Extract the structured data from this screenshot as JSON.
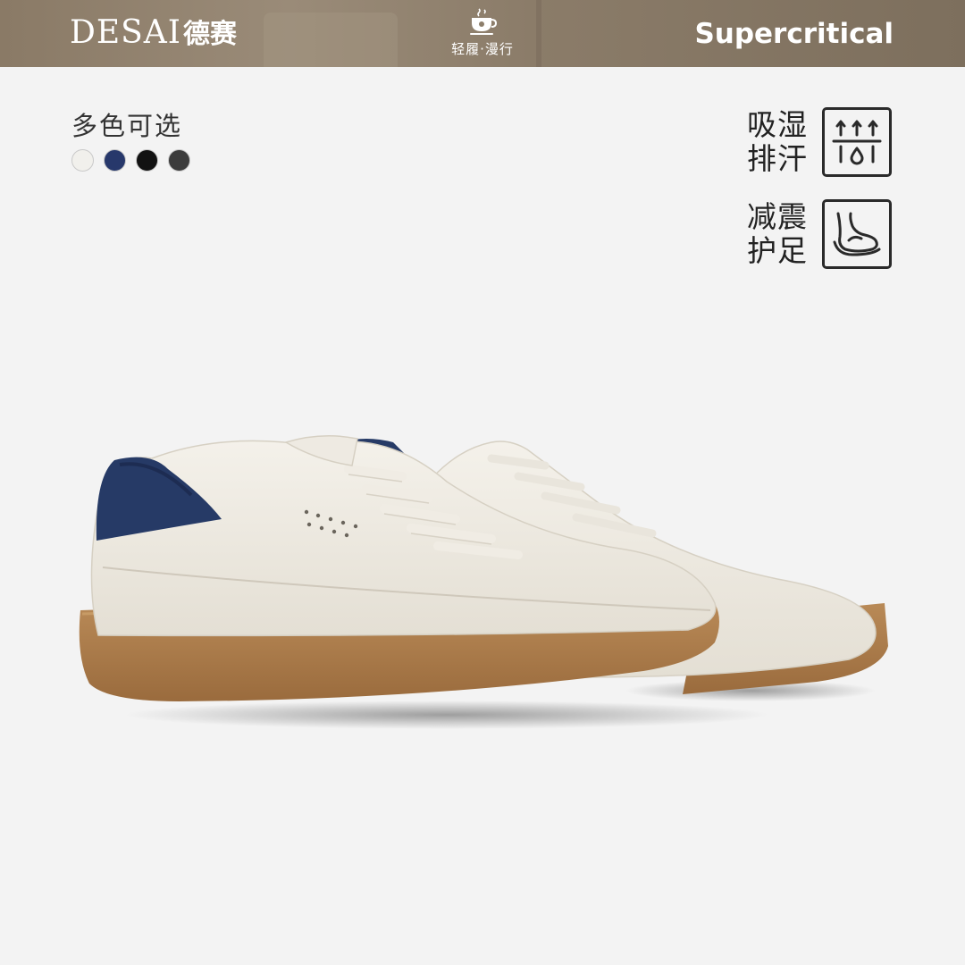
{
  "banner": {
    "brand_en": "DESAI",
    "brand_cn": "德赛",
    "slogan": "轻履·漫行",
    "brand_right": "Supercritical",
    "cup_icon": "coffee-cup-icon"
  },
  "colors": {
    "title": "多色可选",
    "swatches": [
      {
        "name": "white",
        "hex": "#f1f0ec"
      },
      {
        "name": "navy",
        "hex": "#27386b"
      },
      {
        "name": "black",
        "hex": "#121212"
      },
      {
        "name": "charcoal",
        "hex": "#3c3c3c"
      }
    ]
  },
  "features": [
    {
      "line1": "吸湿",
      "line2": "排汗",
      "icon": "moisture-wicking-icon"
    },
    {
      "line1": "减震",
      "line2": "护足",
      "icon": "foot-cushion-icon"
    }
  ],
  "product": {
    "image": "white-sneaker-pair-gum-sole",
    "colors": {
      "upper": "#efebe3",
      "heel_tab": "#263a66",
      "sole": "#b0804f"
    }
  }
}
